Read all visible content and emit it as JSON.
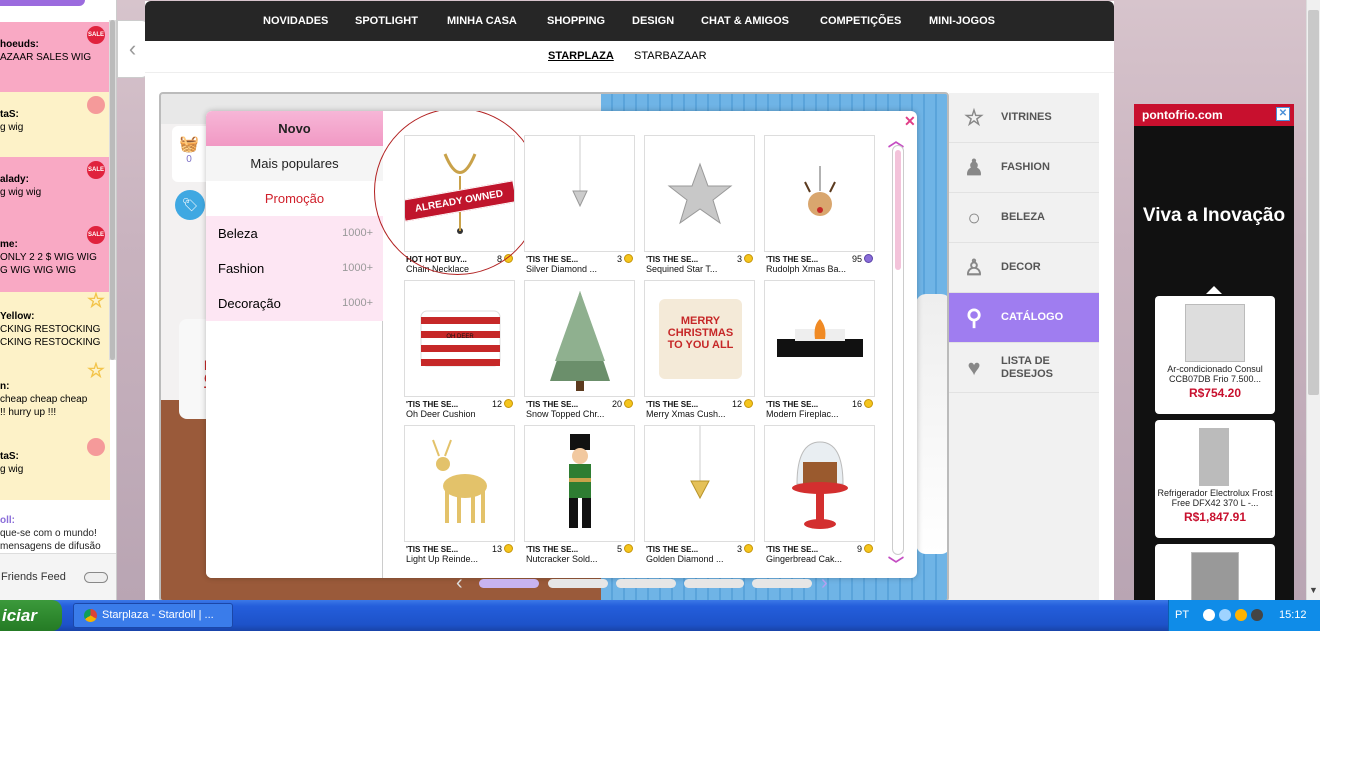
{
  "chat": {
    "messages": [
      {
        "user": "hoeuds:",
        "lines": [
          "AZAAR SALES WIG"
        ],
        "style": "pink",
        "badge": "SALE"
      },
      {
        "user": "taS:",
        "lines": [
          "g wig"
        ],
        "style": "yellow",
        "badge": "face"
      },
      {
        "user": "alady:",
        "lines": [
          "g wig wig"
        ],
        "style": "pink",
        "badge": "SALE"
      },
      {
        "user": "me:",
        "lines": [
          "ONLY 2 2 $ WIG WIG",
          "G WIG WIG WIG"
        ],
        "style": "pink",
        "badge": "SALE"
      },
      {
        "user": "Yellow:",
        "lines": [
          "CKING RESTOCKING",
          "CKING RESTOCKING"
        ],
        "style": "yellow",
        "badge": "star"
      },
      {
        "user": "n:",
        "lines": [
          "cheap cheap cheap",
          "!! hurry up !!!"
        ],
        "style": "yellow",
        "badge": "star"
      },
      {
        "user": "taS:",
        "lines": [
          "g wig"
        ],
        "style": "yellow",
        "badge": "face"
      },
      {
        "user": "oll:",
        "lines": [
          "que-se com o mundo!",
          "mensagens de difusão"
        ],
        "style": "lavender",
        "badge": ""
      }
    ],
    "friends_feed_label": "Friends Feed"
  },
  "top_nav": [
    "NOVIDADES",
    "SPOTLIGHT",
    "MINHA CASA",
    "SHOPPING",
    "DESIGN",
    "CHAT & AMIGOS",
    "COMPETIÇÕES",
    "MINI-JOGOS"
  ],
  "sub_nav": {
    "active": "STARPLAZA",
    "other": "STARBAZAAR"
  },
  "basket": {
    "count": "0"
  },
  "categories": {
    "tabs": [
      "Novo",
      "Mais populares",
      "Promoção"
    ],
    "subs": [
      {
        "label": "Beleza",
        "count": "1000+"
      },
      {
        "label": "Fashion",
        "count": "1000+"
      },
      {
        "label": "Decoração",
        "count": "1000+"
      }
    ]
  },
  "items": [
    {
      "seller": "HOT HOT BUY...",
      "price": "8",
      "currency": "coin",
      "name": "Chain Necklace",
      "owned_label": "ALREADY OWNED"
    },
    {
      "seller": "'TIS THE SE...",
      "price": "3",
      "currency": "coin",
      "name": "Silver Diamond ..."
    },
    {
      "seller": "'TIS THE SE...",
      "price": "3",
      "currency": "coin",
      "name": "Sequined Star T..."
    },
    {
      "seller": "'TIS THE SE...",
      "price": "95",
      "currency": "stardollar",
      "name": "Rudolph Xmas Ba..."
    },
    {
      "seller": "'TIS THE SE...",
      "price": "12",
      "currency": "coin",
      "name": "Oh Deer Cushion",
      "print": "OH DEER"
    },
    {
      "seller": "'TIS THE SE...",
      "price": "20",
      "currency": "coin",
      "name": "Snow Topped Chr..."
    },
    {
      "seller": "'TIS THE SE...",
      "price": "12",
      "currency": "coin",
      "name": "Merry Xmas Cush...",
      "print": "MERRY CHRISTMAS TO YOU ALL"
    },
    {
      "seller": "'TIS THE SE...",
      "price": "16",
      "currency": "coin",
      "name": "Modern Fireplac..."
    },
    {
      "seller": "'TIS THE SE...",
      "price": "13",
      "currency": "coin",
      "name": "Light Up Reinde..."
    },
    {
      "seller": "'TIS THE SE...",
      "price": "5",
      "currency": "coin",
      "name": "Nutcracker Sold..."
    },
    {
      "seller": "'TIS THE SE...",
      "price": "3",
      "currency": "coin",
      "name": "Golden Diamond ..."
    },
    {
      "seller": "'TIS THE SE...",
      "price": "9",
      "currency": "coin",
      "name": "Gingerbread Cak..."
    }
  ],
  "pager": {
    "pages": 5,
    "current": 1
  },
  "side_menu": [
    {
      "label": "VITRINES",
      "icon": "star-icon"
    },
    {
      "label": "FASHION",
      "icon": "dress-icon"
    },
    {
      "label": "BELEZA",
      "icon": "ring-icon"
    },
    {
      "label": "DECOR",
      "icon": "chair-icon"
    },
    {
      "label": "CATÁLOGO",
      "icon": "search-icon",
      "active": true
    },
    {
      "label": "LISTA DE DESEJOS",
      "icon": "heart-icon"
    }
  ],
  "ad": {
    "brand": "pontofrio.com",
    "headline": "Viva a Inovação",
    "products": [
      {
        "name": "Ar-condicionado Consul CCB07DB Frio 7.500...",
        "price": "R$754.20"
      },
      {
        "name": "Refrigerador Electrolux Frost Free DFX42 370 L -...",
        "price": "R$1,847.91"
      }
    ]
  },
  "taskbar": {
    "start_label": "iciar",
    "window_title": "Starplaza - Stardoll | ...",
    "lang": "PT",
    "clock": "15:12"
  },
  "colors": {
    "accent": "#9f7df0",
    "promo": "#d0202b",
    "pink_tab": "#f199c4",
    "nav_bg": "#262626"
  }
}
